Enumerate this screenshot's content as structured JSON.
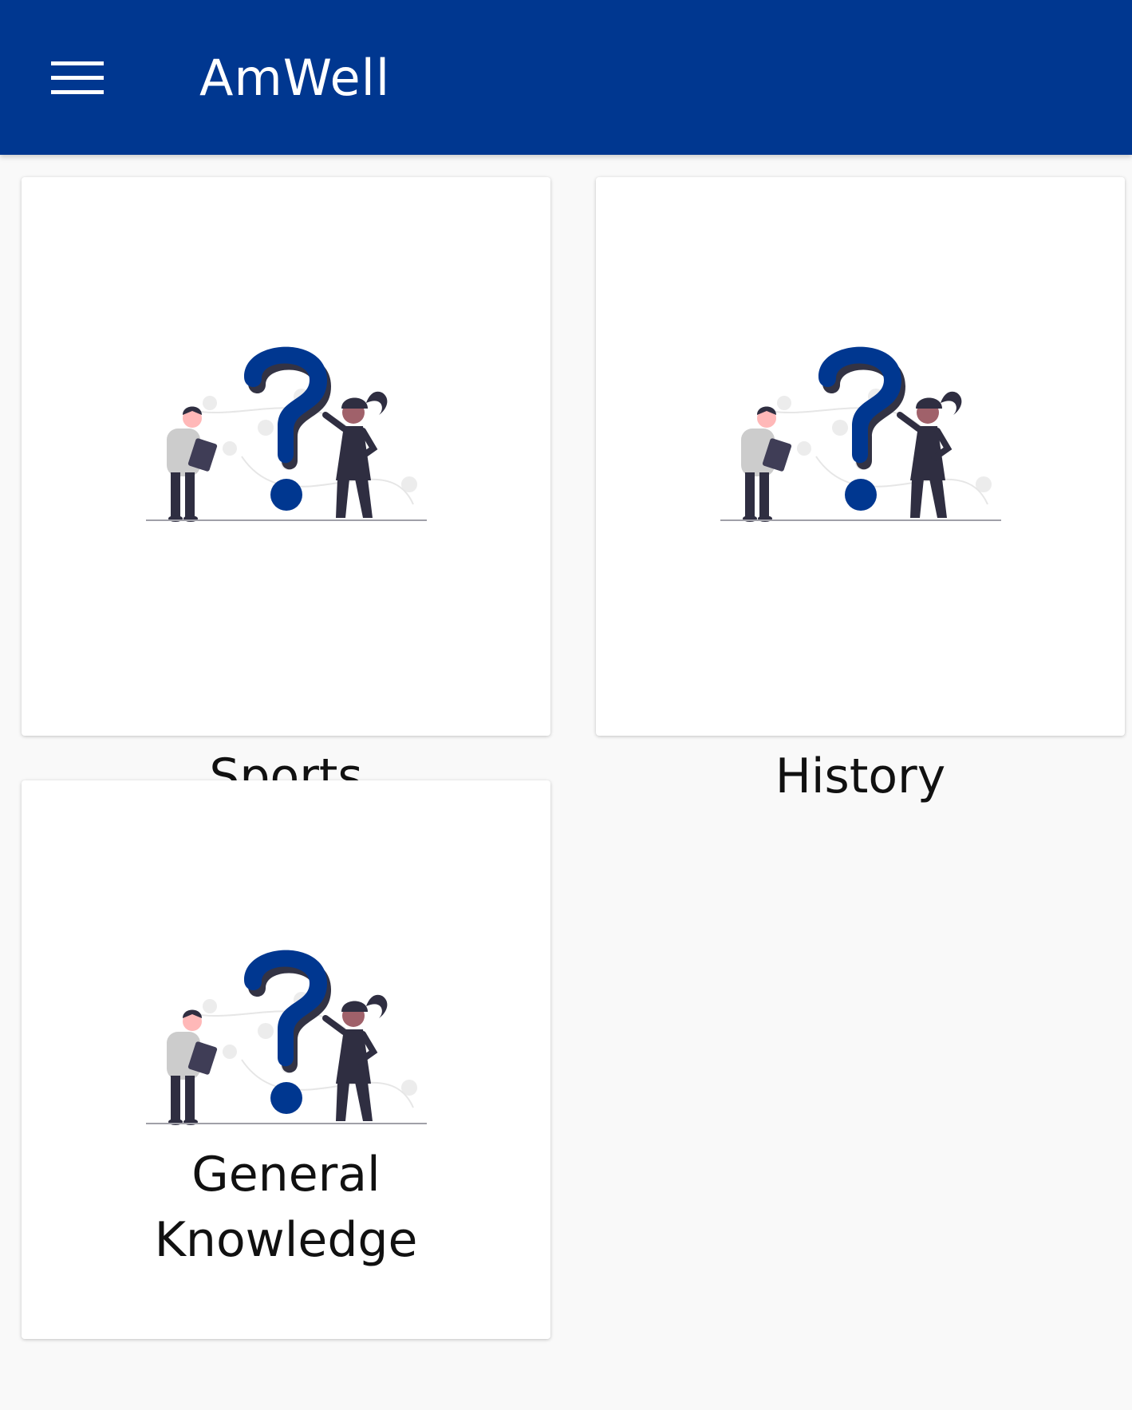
{
  "appbar": {
    "title": "AmWell",
    "menu_icon": "hamburger-menu-icon",
    "background": "#003790"
  },
  "categories": [
    {
      "label": "Sports",
      "illustration": "question-mark-people-illustration"
    },
    {
      "label": "History",
      "illustration": "question-mark-people-illustration"
    },
    {
      "label": "General Knowledge",
      "label_lines": [
        "General",
        "Knowledge"
      ],
      "illustration": "question-mark-people-illustration"
    }
  ],
  "colors": {
    "accent": "#003790",
    "page_background": "#f9f9f9",
    "card_background": "#ffffff",
    "text": "#111111"
  }
}
